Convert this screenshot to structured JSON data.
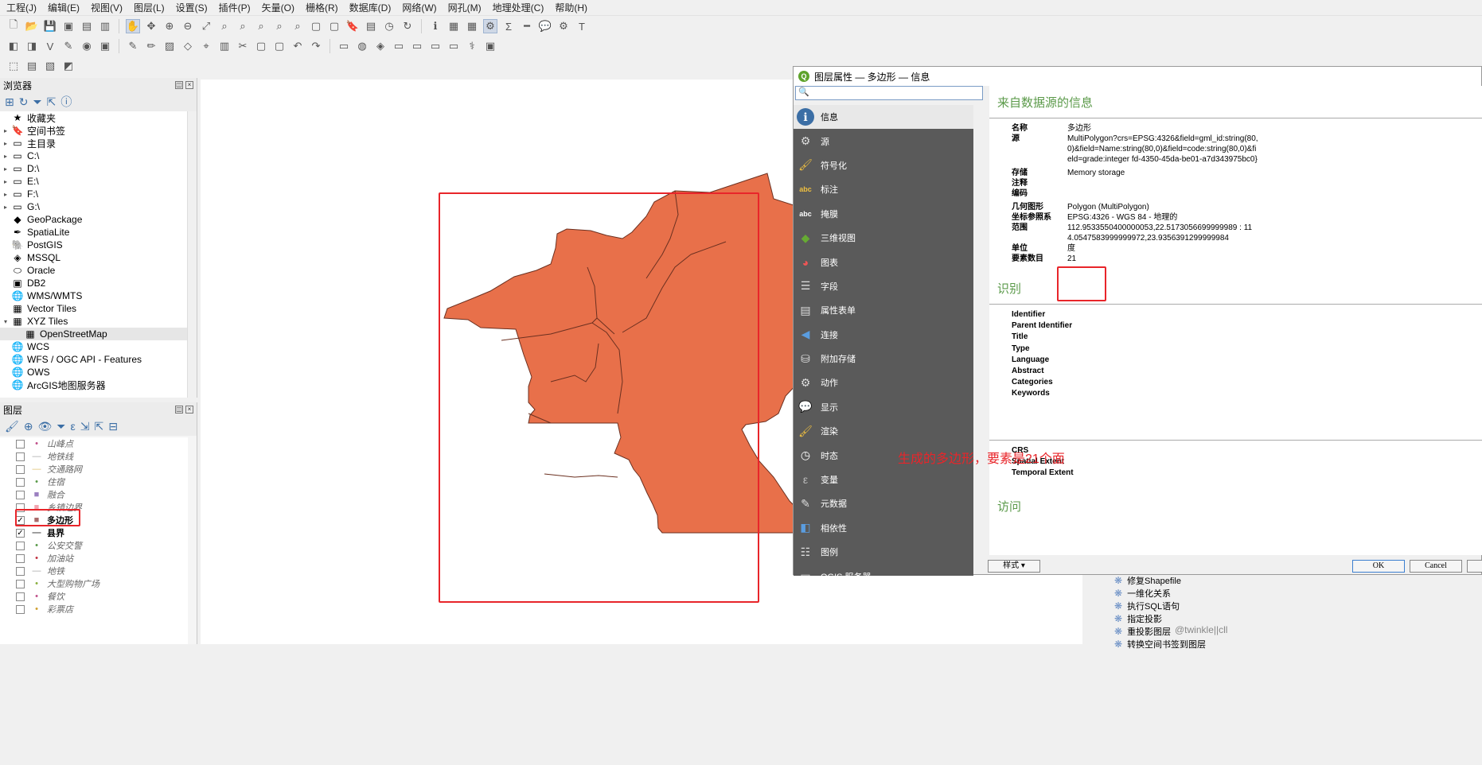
{
  "menu": [
    "工程(J)",
    "编辑(E)",
    "视图(V)",
    "图层(L)",
    "设置(S)",
    "插件(P)",
    "矢量(O)",
    "栅格(R)",
    "数据库(D)",
    "网络(W)",
    "网孔(M)",
    "地理处理(C)",
    "帮助(H)"
  ],
  "browser": {
    "title": "浏览器",
    "items": [
      {
        "label": "收藏夹",
        "icon": "star-icon",
        "arrow": ""
      },
      {
        "label": "空间书签",
        "icon": "bookmark-icon",
        "arrow": "▸"
      },
      {
        "label": "主目录",
        "icon": "folder-icon",
        "arrow": "▸"
      },
      {
        "label": "C:\\",
        "icon": "folder-icon",
        "arrow": "▸"
      },
      {
        "label": "D:\\",
        "icon": "folder-icon",
        "arrow": "▸"
      },
      {
        "label": "E:\\",
        "icon": "folder-icon",
        "arrow": "▸"
      },
      {
        "label": "F:\\",
        "icon": "folder-icon",
        "arrow": "▸"
      },
      {
        "label": "G:\\",
        "icon": "folder-icon",
        "arrow": "▸"
      },
      {
        "label": "GeoPackage",
        "icon": "geopackage-icon",
        "arrow": ""
      },
      {
        "label": "SpatiaLite",
        "icon": "spatialite-icon",
        "arrow": ""
      },
      {
        "label": "PostGIS",
        "icon": "postgis-icon",
        "arrow": ""
      },
      {
        "label": "MSSQL",
        "icon": "mssql-icon",
        "arrow": ""
      },
      {
        "label": "Oracle",
        "icon": "oracle-icon",
        "arrow": ""
      },
      {
        "label": "DB2",
        "icon": "db2-icon",
        "arrow": ""
      },
      {
        "label": "WMS/WMTS",
        "icon": "globe-icon",
        "arrow": ""
      },
      {
        "label": "Vector Tiles",
        "icon": "grid-icon",
        "arrow": ""
      },
      {
        "label": "XYZ Tiles",
        "icon": "grid-icon",
        "arrow": "▾"
      },
      {
        "label": "OpenStreetMap",
        "icon": "grid-icon",
        "arrow": "",
        "indent": true
      },
      {
        "label": "WCS",
        "icon": "globe-icon",
        "arrow": ""
      },
      {
        "label": "WFS / OGC API - Features",
        "icon": "globe-icon",
        "arrow": ""
      },
      {
        "label": "OWS",
        "icon": "globe-icon",
        "arrow": ""
      },
      {
        "label": "ArcGIS地图服务器",
        "icon": "globe-icon",
        "arrow": ""
      }
    ]
  },
  "layers": {
    "title": "图层",
    "items": [
      {
        "label": "山峰点",
        "checked": false,
        "sym": "•",
        "color": "#c0508a"
      },
      {
        "label": "地铁线",
        "checked": false,
        "sym": "—",
        "color": "#aaa"
      },
      {
        "label": "交通路网",
        "checked": false,
        "sym": "—",
        "color": "#e0c070"
      },
      {
        "label": "住宿",
        "checked": false,
        "sym": "•",
        "color": "#5a9a4a"
      },
      {
        "label": "融合",
        "checked": false,
        "sym": "■",
        "color": "#9b7fc0"
      },
      {
        "label": "乡镇边界",
        "checked": false,
        "sym": "■",
        "color": "#f2a5b0"
      },
      {
        "label": "多边形",
        "checked": true,
        "sym": "■",
        "color": "#a86a6a",
        "active": true
      },
      {
        "label": "县界",
        "checked": true,
        "sym": "—",
        "color": "#555",
        "bold": true
      },
      {
        "label": "公安交警",
        "checked": false,
        "sym": "•",
        "color": "#5a9a4a"
      },
      {
        "label": "加油站",
        "checked": false,
        "sym": "•",
        "color": "#c03040"
      },
      {
        "label": "地铁",
        "checked": false,
        "sym": "—",
        "color": "#aaa"
      },
      {
        "label": "大型购物广场",
        "checked": false,
        "sym": "•",
        "color": "#8ab040"
      },
      {
        "label": "餐饮",
        "checked": false,
        "sym": "•",
        "color": "#c0508a"
      },
      {
        "label": "彩票店",
        "checked": false,
        "sym": "•",
        "color": "#d0a030"
      }
    ]
  },
  "dialog": {
    "title": "图层属性 — 多边形 — 信息",
    "nav": [
      {
        "label": "信息",
        "icon": "info-icon"
      },
      {
        "label": "源",
        "icon": "source-icon"
      },
      {
        "label": "符号化",
        "icon": "paintbrush-icon"
      },
      {
        "label": "标注",
        "icon": "label-icon"
      },
      {
        "label": "掩膜",
        "icon": "mask-icon"
      },
      {
        "label": "三维视图",
        "icon": "cube-icon"
      },
      {
        "label": "图表",
        "icon": "chart-icon"
      },
      {
        "label": "字段",
        "icon": "fields-icon"
      },
      {
        "label": "属性表单",
        "icon": "form-icon"
      },
      {
        "label": "连接",
        "icon": "join-icon"
      },
      {
        "label": "附加存储",
        "icon": "storage-icon"
      },
      {
        "label": "动作",
        "icon": "action-icon"
      },
      {
        "label": "显示",
        "icon": "display-icon"
      },
      {
        "label": "渲染",
        "icon": "render-icon"
      },
      {
        "label": "时态",
        "icon": "clock-icon"
      },
      {
        "label": "变量",
        "icon": "variable-icon"
      },
      {
        "label": "元数据",
        "icon": "metadata-icon"
      },
      {
        "label": "相依性",
        "icon": "dependency-icon"
      },
      {
        "label": "图例",
        "icon": "legend-icon"
      },
      {
        "label": "QGIS 服务器",
        "icon": "server-icon"
      }
    ],
    "section1": "来自数据源的信息",
    "info": [
      {
        "k": "名称",
        "v": "多边形"
      },
      {
        "k": "源",
        "v": "MultiPolygon?crs=EPSG:4326&field=gml_id:string(80,0)&field=Name:string(80,0)&field=code:string(80,0)&field=grade:integer fd-4350-45da-be01-a7d343975bc0}"
      },
      {
        "k": "存储",
        "v": "Memory storage"
      },
      {
        "k": "注释",
        "v": ""
      },
      {
        "k": "编码",
        "v": ""
      },
      {
        "k": "几何图形",
        "v": "Polygon (MultiPolygon)"
      },
      {
        "k": "坐标参照系",
        "v": "EPSG:4326 - WGS 84 - 地理的"
      },
      {
        "k": "范围",
        "v": "112.9533550400000053,22.5173056699999989 : 114.0547583999999972,23.9356391299999984"
      },
      {
        "k": "单位",
        "v": "度"
      },
      {
        "k": "要素数目",
        "v": "21"
      }
    ],
    "section2": "识别",
    "ident": [
      "Identifier",
      "Parent Identifier",
      "Title",
      "Type",
      "Language",
      "Abstract",
      "Categories",
      "Keywords"
    ],
    "ident2": [
      "CRS",
      "Spatial Extent",
      "Temporal Extent"
    ],
    "section3": "访问",
    "style_btn": "样式",
    "ok": "OK",
    "cancel": "Cancel"
  },
  "annotation": "生成的多边形，要素是21个面",
  "processing": [
    "修复Shapefile",
    "一维化关系",
    "执行SQL语句",
    "指定投影",
    "重投影图层",
    "转换空间书签到图层"
  ],
  "watermark": "@twinkle||cll",
  "colors": {
    "polygon": "#e8704a",
    "red": "#e8252a"
  }
}
